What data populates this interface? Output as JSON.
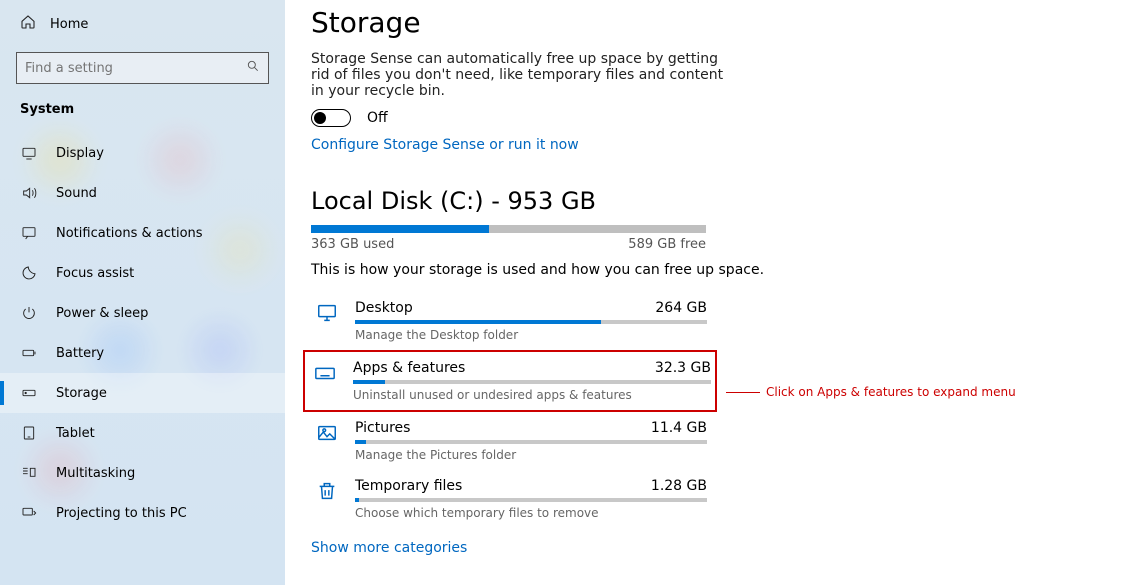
{
  "sidebar": {
    "home": "Home",
    "search_placeholder": "Find a setting",
    "section": "System",
    "items": [
      {
        "label": "Display"
      },
      {
        "label": "Sound"
      },
      {
        "label": "Notifications & actions"
      },
      {
        "label": "Focus assist"
      },
      {
        "label": "Power & sleep"
      },
      {
        "label": "Battery"
      },
      {
        "label": "Storage",
        "selected": true
      },
      {
        "label": "Tablet"
      },
      {
        "label": "Multitasking"
      },
      {
        "label": "Projecting to this PC"
      }
    ]
  },
  "page": {
    "title": "Storage",
    "sense_desc": "Storage Sense can automatically free up space by getting rid of files you don't need, like temporary files and content in your recycle bin.",
    "toggle_state": "Off",
    "configure_link": "Configure Storage Sense or run it now",
    "disk_title": "Local Disk (C:) - 953 GB",
    "used_label": "363 GB used",
    "free_label": "589 GB free",
    "used_pct": 45,
    "how_text": "This is how your storage is used and how you can free up space.",
    "more_link": "Show more categories"
  },
  "categories": [
    {
      "name": "Desktop",
      "size": "264 GB",
      "sub": "Manage the Desktop folder",
      "pct": 70,
      "icon": "monitor"
    },
    {
      "name": "Apps & features",
      "size": "32.3 GB",
      "sub": "Uninstall unused or undesired apps & features",
      "pct": 9,
      "icon": "keyboard",
      "highlight": true
    },
    {
      "name": "Pictures",
      "size": "11.4 GB",
      "sub": "Manage the Pictures folder",
      "pct": 3,
      "icon": "picture"
    },
    {
      "name": "Temporary files",
      "size": "1.28 GB",
      "sub": "Choose which temporary files to remove",
      "pct": 1,
      "icon": "trash"
    }
  ],
  "annotation": "Click on Apps & features to expand menu"
}
